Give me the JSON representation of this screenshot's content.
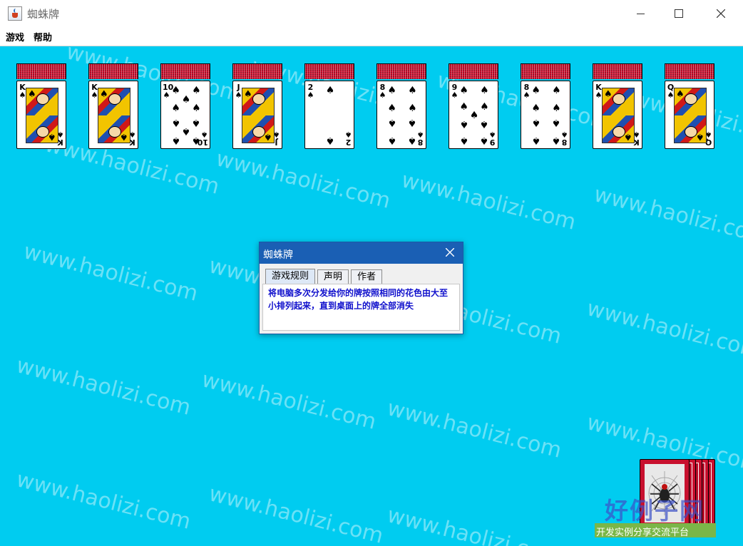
{
  "window": {
    "title": "蜘蛛牌",
    "icon": "java-cup-icon"
  },
  "menu": {
    "items": [
      "游戏",
      "帮助"
    ]
  },
  "watermark": {
    "text": "www.haolizi.com"
  },
  "columns": [
    {
      "rank": "K",
      "suit": "♠",
      "face": true,
      "backs": 1
    },
    {
      "rank": "K",
      "suit": "♠",
      "face": true,
      "backs": 1
    },
    {
      "rank": "10",
      "suit": "♠",
      "face": false,
      "backs": 1
    },
    {
      "rank": "J",
      "suit": "♠",
      "face": true,
      "backs": 1
    },
    {
      "rank": "2",
      "suit": "♠",
      "face": false,
      "backs": 1
    },
    {
      "rank": "8",
      "suit": "♠",
      "face": false,
      "backs": 1
    },
    {
      "rank": "9",
      "suit": "♠",
      "face": false,
      "backs": 1
    },
    {
      "rank": "8",
      "suit": "♠",
      "face": false,
      "backs": 1
    },
    {
      "rank": "K",
      "suit": "♠",
      "face": true,
      "backs": 1
    },
    {
      "rank": "Q",
      "suit": "♠",
      "face": true,
      "backs": 1
    }
  ],
  "stock": {
    "piles": 5,
    "icon": "spider-icon"
  },
  "dialog": {
    "title": "蜘蛛牌",
    "tabs": [
      "游戏规则",
      "声明",
      "作者"
    ],
    "active_tab": 0,
    "content": "将电脑多次分发给你的牌按照相同的花色由大至小排列起来，直到桌面上的牌全部消失"
  },
  "logo": {
    "main": "好例子网",
    "sub": "开发实例分享交流平台"
  },
  "colors": {
    "board": "#00ccf0",
    "card_back": "#c8102e",
    "dialog_title": "#1a5fb4",
    "dialog_text": "#1010cc"
  }
}
